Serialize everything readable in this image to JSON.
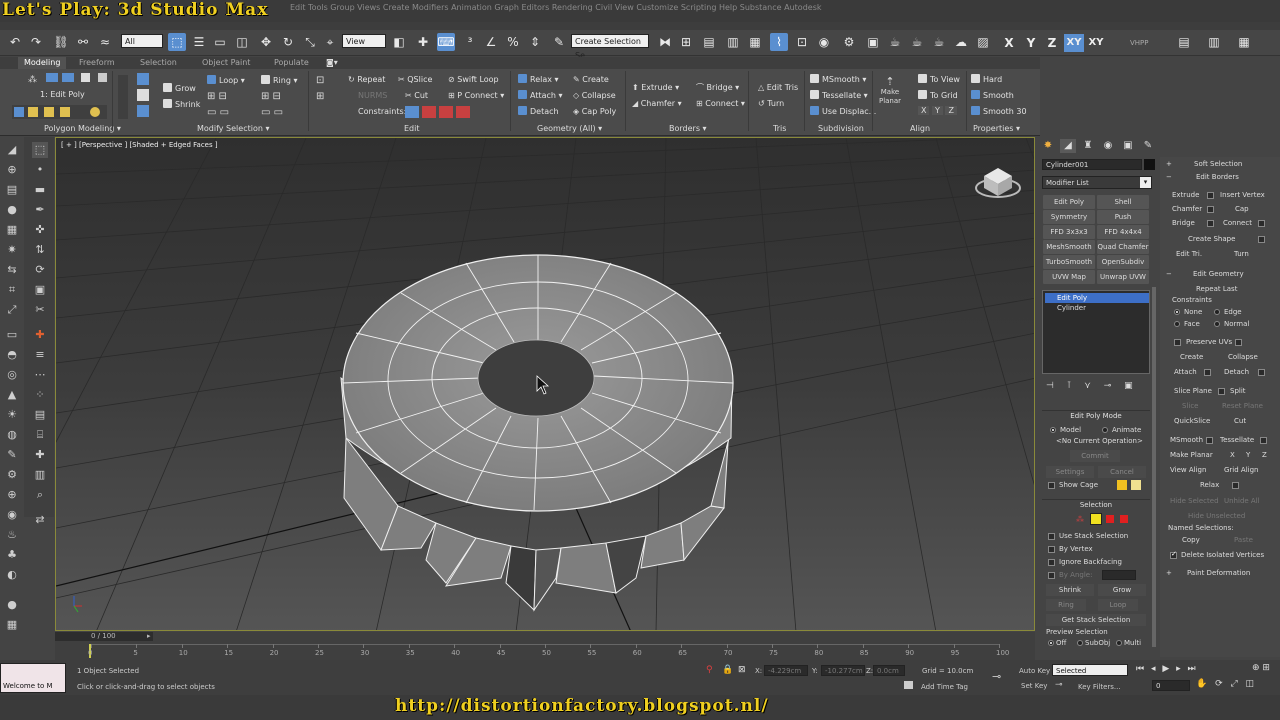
{
  "overlay_title": "Let's Play: 3d Studio Max",
  "menubar_ghost": "Edit   Tools   Group   Views   Create   Modifiers   Animation   Graph Editors   Rendering   Civil View   Customize   Scripting   Help   Substance   Autodesk",
  "toolbar": {
    "filter_value": "All",
    "view_value": "View",
    "selection_set": "Create Selection Se",
    "axes": [
      "X",
      "Y",
      "Z",
      "XY",
      "XY"
    ],
    "vhpp": "VHPP"
  },
  "ribbon": {
    "tabs": [
      "Modeling",
      "Freeform",
      "Selection",
      "Object Paint",
      "Populate"
    ],
    "active_tab": "Modeling",
    "edit_poly_label": "1: Edit Poly",
    "grow": "Grow",
    "shrink": "Shrink",
    "loop": "Loop",
    "ring": "Ring",
    "repeat": "Repeat",
    "qslice": "QSlice",
    "swift_loop": "Swift Loop",
    "nurms": "NURMS",
    "cut": "Cut",
    "p_connect": "P Connect",
    "constraints": "Constraints:",
    "relax": "Relax",
    "create": "Create",
    "attach": "Attach",
    "collapse": "Collapse",
    "detach": "Detach",
    "cap_poly": "Cap Poly",
    "extrude": "Extrude",
    "bridge": "Bridge",
    "chamfer": "Chamfer",
    "connect": "Connect",
    "edit_tris": "Edit Tris",
    "turn": "Turn",
    "msmooth": "MSmooth",
    "tessellate": "Tessellate",
    "use_displac": "Use Displac...",
    "make_planar": "Make Planar",
    "to_view": "To View",
    "to_grid": "To Grid",
    "xyz": [
      "X",
      "Y",
      "Z"
    ],
    "hard": "Hard",
    "smooth": "Smooth",
    "smooth30": "Smooth 30",
    "groups": [
      "Polygon Modeling ▾",
      "Modify Selection ▾",
      "Edit",
      "Geometry (All) ▾",
      "Borders ▾",
      "Tris",
      "Subdivision",
      "Align",
      "Properties ▾"
    ]
  },
  "viewport": {
    "label": "[ + ] [Perspective ] [Shaded + Edged Faces ]"
  },
  "command_panel": {
    "object_name": "Cylinder001",
    "modifier_list": "Modifier List",
    "modifier_buttons": [
      "Edit Poly",
      "Shell",
      "Symmetry",
      "Push",
      "FFD 3x3x3",
      "FFD 4x4x4",
      "MeshSmooth",
      "Quad Chamfer",
      "TurboSmooth",
      "OpenSubdiv",
      "UVW Map",
      "Unwrap UVW"
    ],
    "stack_items": [
      "Edit Poly",
      "Cylinder"
    ],
    "edit_poly_mode": "Edit Poly Mode",
    "model": "Model",
    "animate": "Animate",
    "no_op": "<No Current Operation>",
    "commit": "Commit",
    "settings": "Settings",
    "cancel": "Cancel",
    "show_cage": "Show Cage",
    "selection": "Selection",
    "use_stack": "Use Stack Selection",
    "by_vertex": "By Vertex",
    "ignore_backfacing": "Ignore Backfacing",
    "by_angle": "By Angle:",
    "shrink": "Shrink",
    "grow": "Grow",
    "ring": "Ring",
    "loop": "Loop",
    "get_stack": "Get Stack Selection",
    "preview_selection": "Preview Selection",
    "off": "Off",
    "subobj": "SubObj",
    "multi": "Multi"
  },
  "right_panel": {
    "soft_selection": "Soft Selection",
    "edit_borders": "Edit Borders",
    "extrude": "Extrude",
    "insert_vertex": "Insert Vertex",
    "chamfer": "Chamfer",
    "cap": "Cap",
    "bridge": "Bridge",
    "connect": "Connect",
    "create_shape": "Create Shape",
    "edit_tri": "Edit Tri.",
    "turn": "Turn",
    "edit_geometry": "Edit Geometry",
    "repeat_last": "Repeat Last",
    "constraints": "Constraints",
    "none": "None",
    "edge": "Edge",
    "face": "Face",
    "normal": "Normal",
    "preserve_uvs": "Preserve UVs",
    "create": "Create",
    "collapse": "Collapse",
    "attach": "Attach",
    "detach": "Detach",
    "slice_plane": "Slice Plane",
    "split": "Split",
    "slice": "Slice",
    "reset_plane": "Reset Plane",
    "quickslice": "QuickSlice",
    "cut": "Cut",
    "msmooth": "MSmooth",
    "tessellate": "Tessellate",
    "make_planar": "Make Planar",
    "xyz": [
      "X",
      "Y",
      "Z"
    ],
    "view_align": "View Align",
    "grid_align": "Grid Align",
    "relax": "Relax",
    "hide_selected": "Hide Selected",
    "unhide_all": "Unhide All",
    "hide_unselected": "Hide Unselected",
    "named_selections": "Named Selections:",
    "copy": "Copy",
    "paste": "Paste",
    "delete_isolated": "Delete Isolated Vertices",
    "paint_deformation": "Paint Deformation"
  },
  "timeline": {
    "frame": "0 / 100",
    "ticks": [
      "0",
      "5",
      "10",
      "15",
      "20",
      "25",
      "30",
      "35",
      "40",
      "45",
      "50",
      "55",
      "60",
      "65",
      "70",
      "75",
      "80",
      "85",
      "90",
      "95",
      "100"
    ]
  },
  "status": {
    "welcome": "Welcome to M",
    "objects_selected": "1 Object Selected",
    "prompt": "Click or click-and-drag to select objects",
    "x_label": "X:",
    "x_value": "-4.229cm",
    "y_label": "Y:",
    "y_value": "-10.277cm",
    "z_label": "Z:",
    "z_value": "0.0cm",
    "grid": "Grid = 10.0cm",
    "add_time_tag": "Add Time Tag",
    "auto_key": "Auto Key",
    "selected": "Selected",
    "set_key": "Set Key",
    "key_filters": "Key Filters...",
    "frame_value": "0"
  },
  "url": "http://distortionfactory.blogspot.nl/",
  "colors": {
    "accent_blue": "#5a8fd0",
    "overlay_yellow": "#f0d020",
    "stack_selected": "#3d6fc7"
  }
}
